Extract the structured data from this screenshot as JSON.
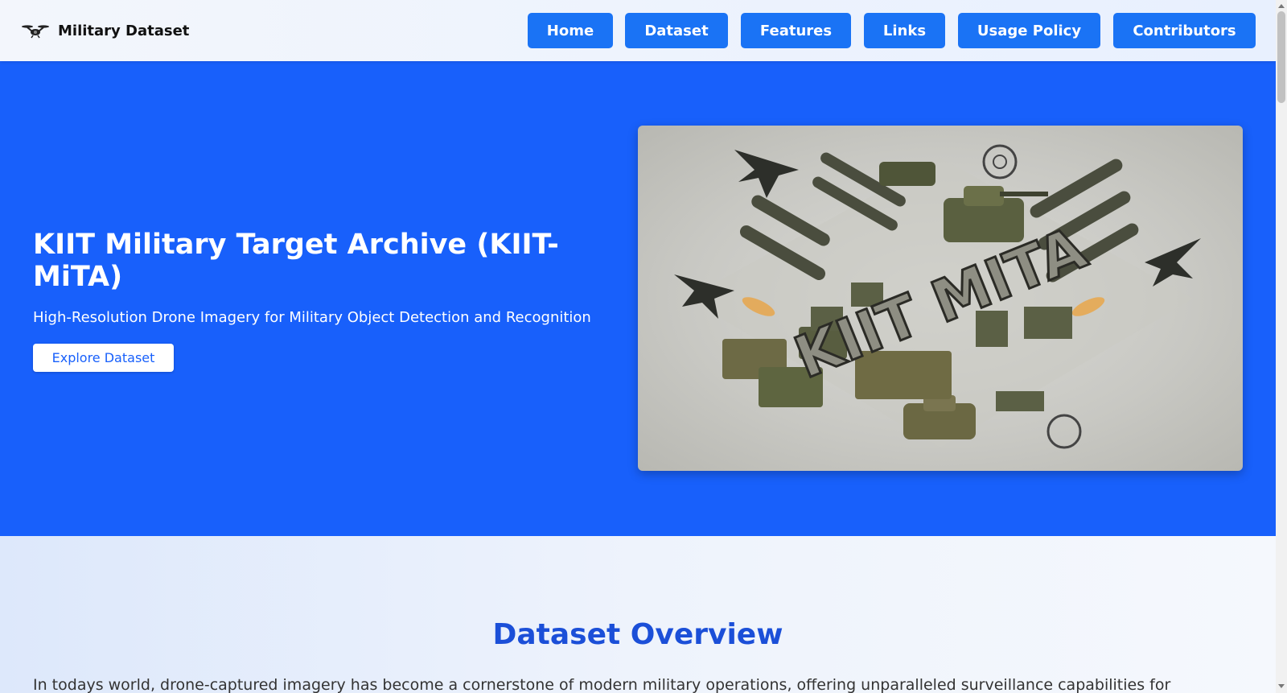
{
  "brand": {
    "name": "Military Dataset",
    "icon": "drone-icon"
  },
  "nav": {
    "items": [
      {
        "label": "Home"
      },
      {
        "label": "Dataset"
      },
      {
        "label": "Features"
      },
      {
        "label": "Links"
      },
      {
        "label": "Usage Policy"
      },
      {
        "label": "Contributors"
      }
    ]
  },
  "hero": {
    "title": "KIIT Military Target Archive (KIIT-MiTA)",
    "subtitle": "High-Resolution Drone Imagery for Military Object Detection and Recognition",
    "cta_label": "Explore Dataset",
    "image_text": "KIIT MITA"
  },
  "overview": {
    "title": "Dataset Overview",
    "body": "In todays world, drone-captured imagery has become a cornerstone of modern military operations, offering unparalleled surveillance capabilities for"
  },
  "colors": {
    "nav_button": "#1a73f5",
    "hero_background": "#1860fb",
    "overview_title": "#1b4fd8"
  }
}
